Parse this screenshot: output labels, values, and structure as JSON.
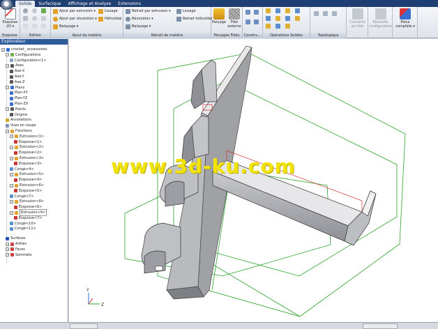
{
  "tabs": [
    "Solide",
    "Surfacique",
    "Affichage et Analyse",
    "Extensions"
  ],
  "active_tab": "Solide",
  "ribbon": {
    "esquisse": {
      "big_label": "Esquisse\n2D ▾",
      "group_label": "Esquisse"
    },
    "edition": {
      "group_label": "Edition"
    },
    "ajout": {
      "group_label": "Ajout de matière",
      "extrusion": "Ajout par extrusion ▾",
      "revolution": "Ajout par révolution ▾",
      "balayage": "Balayage ▾",
      "lissage": "Lissage",
      "helicoidal": "Hélicoïdal"
    },
    "retrait": {
      "group_label": "Retrait de matière",
      "extrusion": "Retrait par extrusion ▾",
      "revolution": "Révolution ▾",
      "balayage": "Balayage ▾",
      "lissage": "Lissage",
      "helicoidal": "Retrait hélicoïdal"
    },
    "percages": {
      "group_label": "Perçages Filets",
      "percage": "Perçage",
      "filet": "Filet\nexterne"
    },
    "construction": {
      "group_label": "Constru..."
    },
    "operations": {
      "group_label": "Opérations Solides"
    },
    "topologique": {
      "group_label": "Topologique"
    },
    "convertir": {
      "label": "Convertir\nen tôle",
      "group_label": ""
    },
    "nouvelle": {
      "label": "Nouvelle\nconfiguration"
    },
    "piece": {
      "label": "Pièce\ncomplète ▾"
    }
  },
  "explorer": {
    "title": "Explorateur",
    "nodes": [
      "crochet_ accessoires",
      "Configurations",
      "Configuration<1>",
      "Axes",
      "Axe-X",
      "Axe-Y",
      "Axe-Z",
      "Plans",
      "Plan-XY",
      "Plan-YZ",
      "Plan-ZX",
      "Points",
      "Origine",
      "Annotations",
      "Vues en coupe",
      "Fonctions",
      "Extrusion<1>",
      "Esquisse<1>",
      "Extrusion<2>",
      "Esquisse<2>",
      "Extrusion<3>",
      "Esquisse<3>",
      "Congé<4>",
      "Extrusion<5>",
      "Esquisse<4>",
      "Extrusion<6>",
      "Esquisse<5>",
      "Congé<7>",
      "Extrusion<8>",
      "Esquisse<6>",
      "Extrusion<9>",
      "Esquisse<7>",
      "Congé<10>",
      "Congé<11>",
      "Surfaces",
      "Arêtes",
      "Faces",
      "Sommets"
    ]
  },
  "viewport": {
    "watermark": "www.3d-ku.com",
    "triad": {
      "y": "Y",
      "z": "Z"
    }
  },
  "colors": {
    "accent": "#1f3f73",
    "solid": "#a9aaae",
    "box": "#2aa12a",
    "sketch": "#cc3333"
  }
}
